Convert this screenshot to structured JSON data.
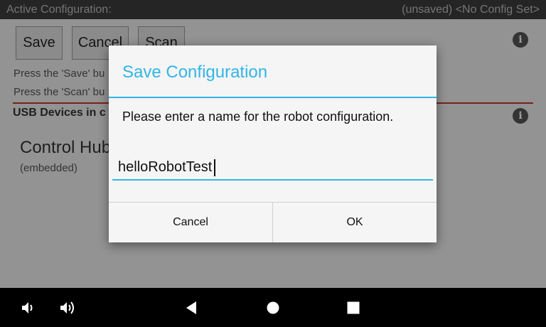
{
  "titlebar": {
    "left": "Active Configuration:",
    "right": "(unsaved) <No Config Set>"
  },
  "toolbar": {
    "save_label": "Save",
    "cancel_label": "Cancel",
    "scan_label": "Scan"
  },
  "info_icon_glyph": "i",
  "hints": {
    "save": "Press the 'Save' bu",
    "scan": "Press the 'Scan' bu"
  },
  "usb": {
    "heading": "USB Devices in c",
    "device_name": "Control Hub",
    "device_sub": "(embedded)"
  },
  "dialog": {
    "title": "Save Configuration",
    "message": "Please enter a name for the robot configuration.",
    "input_value": "helloRobotTest",
    "cancel_label": "Cancel",
    "ok_label": "OK"
  },
  "nav": {
    "icons": [
      "volume-down-icon",
      "volume-up-icon",
      "back-icon",
      "home-icon",
      "recents-icon"
    ]
  },
  "colors": {
    "accent": "#33b5e5",
    "divider_red": "#c0392b",
    "titlebar_bg": "#3c3c3c",
    "navbar_bg": "#000000"
  }
}
